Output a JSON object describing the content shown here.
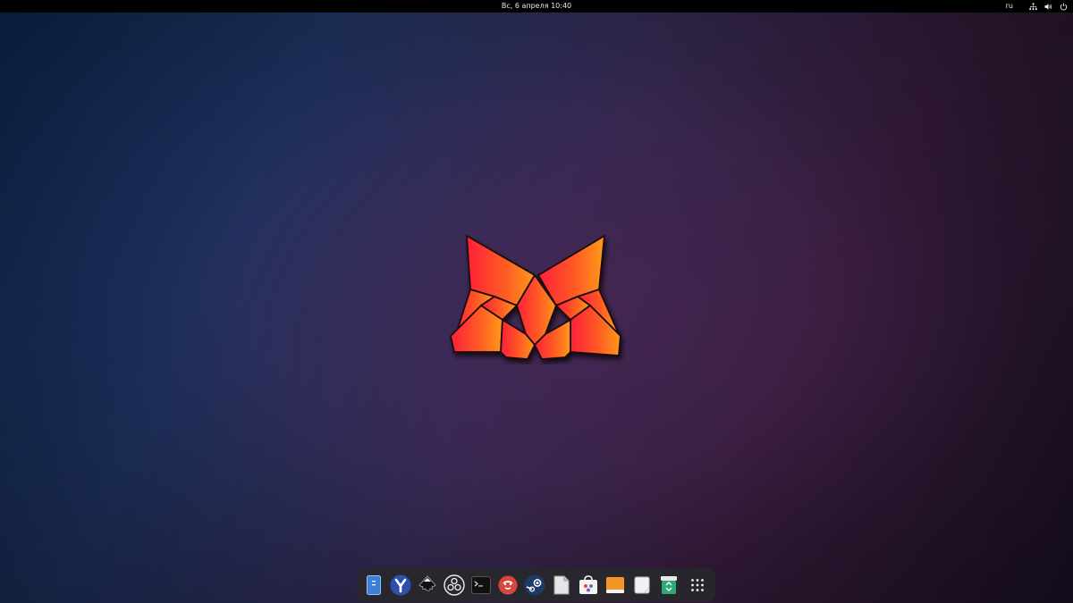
{
  "topbar": {
    "datetime": "Вс, 6 апреля  10:40",
    "keyboard_layout": "ru",
    "tray_icons": [
      "network-icon",
      "volume-icon",
      "power-icon"
    ]
  },
  "wallpaper": {
    "colors": [
      "#0f2a55",
      "#33284f",
      "#351b3a"
    ],
    "logo": "origami-fox-logo",
    "logo_gradient": [
      "#ff1f3a",
      "#ff9a1a"
    ]
  },
  "dock": {
    "items": [
      {
        "name": "files-icon"
      },
      {
        "name": "yandex-browser-icon"
      },
      {
        "name": "inkscape-icon"
      },
      {
        "name": "obs-studio-icon"
      },
      {
        "name": "terminal-icon"
      },
      {
        "name": "fotoxx-icon"
      },
      {
        "name": "steam-icon"
      },
      {
        "name": "libreoffice-icon"
      },
      {
        "name": "software-store-icon"
      },
      {
        "name": "drive-icon"
      },
      {
        "name": "text-document-icon"
      },
      {
        "name": "trash-icon"
      },
      {
        "name": "app-grid-icon"
      }
    ]
  }
}
